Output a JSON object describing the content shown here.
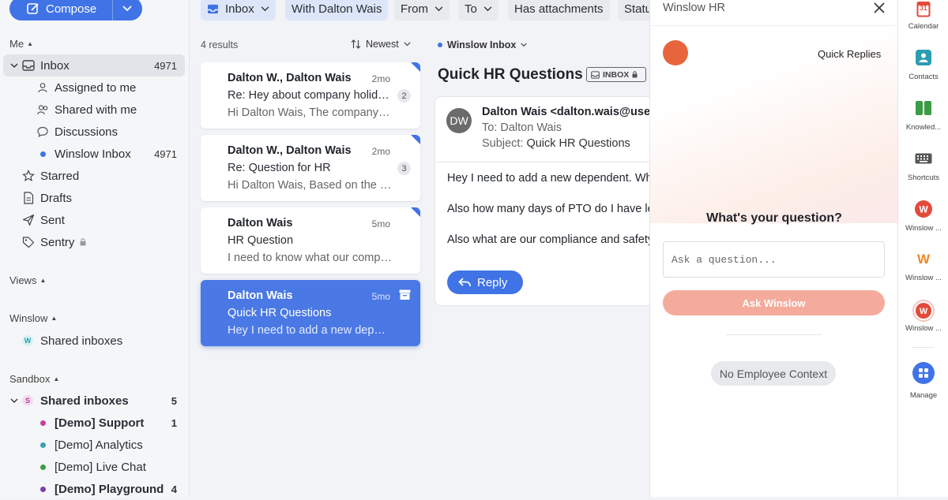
{
  "compose": {
    "label": "Compose"
  },
  "sidebar": {
    "me_label": "Me",
    "inbox": {
      "label": "Inbox",
      "count": "4971"
    },
    "assigned": {
      "label": "Assigned to me"
    },
    "shared": {
      "label": "Shared with me"
    },
    "discussions": {
      "label": "Discussions"
    },
    "winslow_inbox": {
      "label": "Winslow Inbox",
      "count": "4971"
    },
    "starred": {
      "label": "Starred"
    },
    "drafts": {
      "label": "Drafts"
    },
    "sent": {
      "label": "Sent"
    },
    "sentry": {
      "label": "Sentry"
    },
    "views_label": "Views",
    "winslow_label": "Winslow",
    "winslow_shared": {
      "label": "Shared inboxes",
      "badge": "W"
    },
    "sandbox_label": "Sandbox",
    "sandbox_shared": {
      "label": "Shared inboxes",
      "badge": "S",
      "count": "5"
    },
    "demo": [
      {
        "label": "[Demo] Support",
        "count": "1",
        "color": "#c2409a",
        "bold": true
      },
      {
        "label": "[Demo] Analytics",
        "count": "",
        "color": "#3aa0b8",
        "bold": false
      },
      {
        "label": "[Demo] Live Chat",
        "count": "",
        "color": "#3c9b45",
        "bold": false
      },
      {
        "label": "[Demo] Playground",
        "count": "4",
        "color": "#7b3fb0",
        "bold": true
      }
    ]
  },
  "filters": {
    "inbox": "Inbox",
    "with": "With Dalton Wais",
    "from": "From",
    "to": "To",
    "attachments": "Has attachments",
    "status": "Status"
  },
  "list": {
    "results": "4 results",
    "sort": "Newest",
    "items": [
      {
        "from": "Dalton W., Dalton Wais",
        "time": "2mo",
        "subject": "Re: Hey about company holidays",
        "snippet": "Hi Dalton Wais, The company-wide holidays",
        "count": "2"
      },
      {
        "from": "Dalton W., Dalton Wais",
        "time": "2mo",
        "subject": "Re: Question for HR",
        "snippet": "Hi Dalton Wais, Based on the policy",
        "count": "3"
      },
      {
        "from": "Dalton Wais",
        "time": "5mo",
        "subject": "HR Question",
        "snippet": "I need to know what our company policy is",
        "count": ""
      },
      {
        "from": "Dalton Wais",
        "time": "5mo",
        "subject": "Quick HR Questions",
        "snippet": "Hey I need to add a new dependent",
        "count": ""
      }
    ]
  },
  "message": {
    "inbox_label": "Winslow Inbox",
    "subject": "Quick HR Questions",
    "tag": "INBOX",
    "avatar": "DW",
    "from_line": "Dalton Wais <dalton.wais@usewinslow.com>",
    "to_line": "To: Dalton Wais",
    "subject_prefix": "Subject:",
    "subject_value": "Quick HR Questions",
    "body": [
      "Hey I need to add a new dependent.  What do I need to do?",
      "Also how many days of PTO do I have left?",
      "Also what are our compliance and safety policies?"
    ],
    "reply": "Reply"
  },
  "panel": {
    "title": "Winslow HR",
    "quick_replies": "Quick Replies",
    "question": "What's your question?",
    "placeholder": "Ask a question...",
    "ask": "Ask Winslow",
    "no_context": "No Employee Context",
    "accent": "#e8643c"
  },
  "rail": {
    "calendar": "Calendar",
    "calendar_day": "31",
    "contacts": "Contacts",
    "knowledge": "Knowled...",
    "shortcuts": "Shortcuts",
    "winslow1": "Winslow ...",
    "winslow2": "Winslow ...",
    "winslow3": "Winslow ...",
    "manage": "Manage"
  }
}
